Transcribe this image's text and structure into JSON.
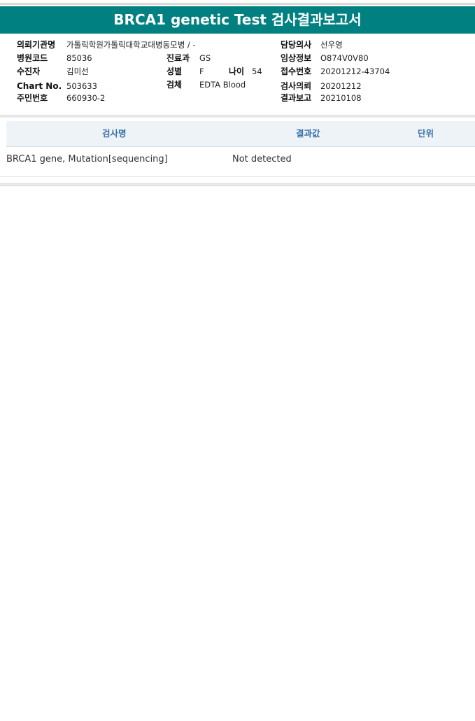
{
  "report": {
    "title": "BRCA1 genetic Test 검사결과보고서"
  },
  "patient_info": {
    "institution": {
      "label": "의뢰기관명",
      "value": "가톨릭학원가톨릭대학교대병동모병 / -"
    },
    "hospital_code": {
      "label": "병원코드",
      "value": "85036"
    },
    "recipient": {
      "label": "수진자",
      "value": "김미선"
    },
    "chart_no": {
      "label": "Chart No.",
      "value": "503633"
    },
    "resident_no": {
      "label": "주민번호",
      "value": "660930-2"
    },
    "department": {
      "label": "진료과",
      "value": "GS"
    },
    "sex": {
      "label": "성별",
      "value": "F"
    },
    "age": {
      "label": "나이",
      "value": "54"
    },
    "specimen": {
      "label": "검체",
      "value": "EDTA Blood"
    },
    "doctor": {
      "label": "담당의사",
      "value": "선우영"
    },
    "clinical_info": {
      "label": "임상정보",
      "value": "O874V0V80"
    },
    "receipt_no": {
      "label": "접수번호",
      "value": "20201212-43704"
    },
    "test_request": {
      "label": "검사의뢰",
      "value": "20201212"
    },
    "result_report": {
      "label": "결과보고",
      "value": "20210108"
    }
  },
  "results_table": {
    "headers": {
      "test_name": "검사명",
      "result": "결과값",
      "unit": "단위"
    },
    "rows": [
      {
        "test_name": "BRCA1 gene, Mutation[sequencing]",
        "result": "Not detected",
        "unit": ""
      }
    ]
  },
  "colors": {
    "title_bar": "#008080",
    "header_text": "#3a72a8",
    "header_bg": "#eef3f8"
  }
}
